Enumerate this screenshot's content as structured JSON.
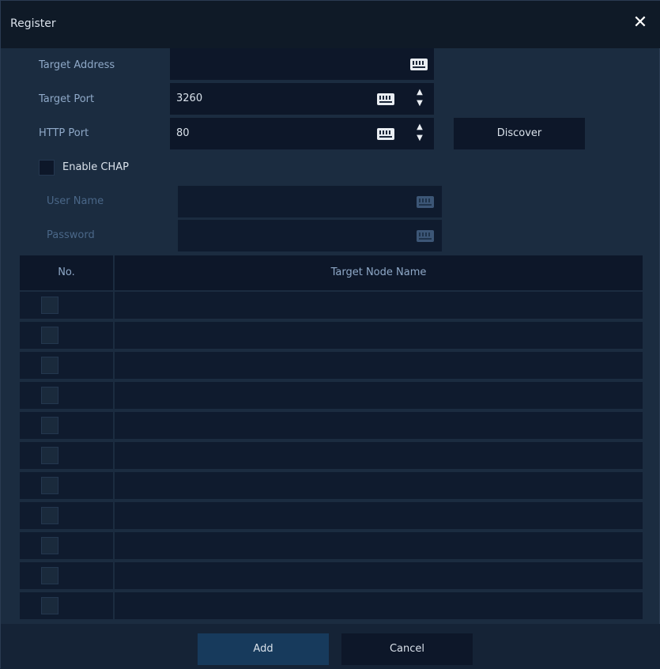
{
  "dialog": {
    "title": "Register",
    "close_icon": "close-icon"
  },
  "form": {
    "target_address": {
      "label": "Target Address",
      "value": ""
    },
    "target_port": {
      "label": "Target Port",
      "value": "3260"
    },
    "http_port": {
      "label": "HTTP Port",
      "value": "80"
    },
    "discover_label": "Discover",
    "enable_chap": {
      "label": "Enable CHAP",
      "checked": false
    },
    "user_name": {
      "label": "User Name",
      "value": ""
    },
    "password": {
      "label": "Password",
      "value": ""
    },
    "icons": {
      "keyboard": "keyboard-icon",
      "spin": "spin-up-down-icon"
    }
  },
  "table": {
    "columns": [
      "No.",
      "Target Node Name"
    ],
    "rows": [
      {
        "no": "",
        "name": ""
      },
      {
        "no": "",
        "name": ""
      },
      {
        "no": "",
        "name": ""
      },
      {
        "no": "",
        "name": ""
      },
      {
        "no": "",
        "name": ""
      },
      {
        "no": "",
        "name": ""
      },
      {
        "no": "",
        "name": ""
      },
      {
        "no": "",
        "name": ""
      },
      {
        "no": "",
        "name": ""
      },
      {
        "no": "",
        "name": ""
      },
      {
        "no": "",
        "name": ""
      }
    ]
  },
  "footer": {
    "add_label": "Add",
    "cancel_label": "Cancel"
  },
  "colors": {
    "background": "#1b2c40",
    "field": "#0d1729",
    "label": "#8fa9c8",
    "text": "#d9e1ea",
    "accent": "#173a5c"
  }
}
